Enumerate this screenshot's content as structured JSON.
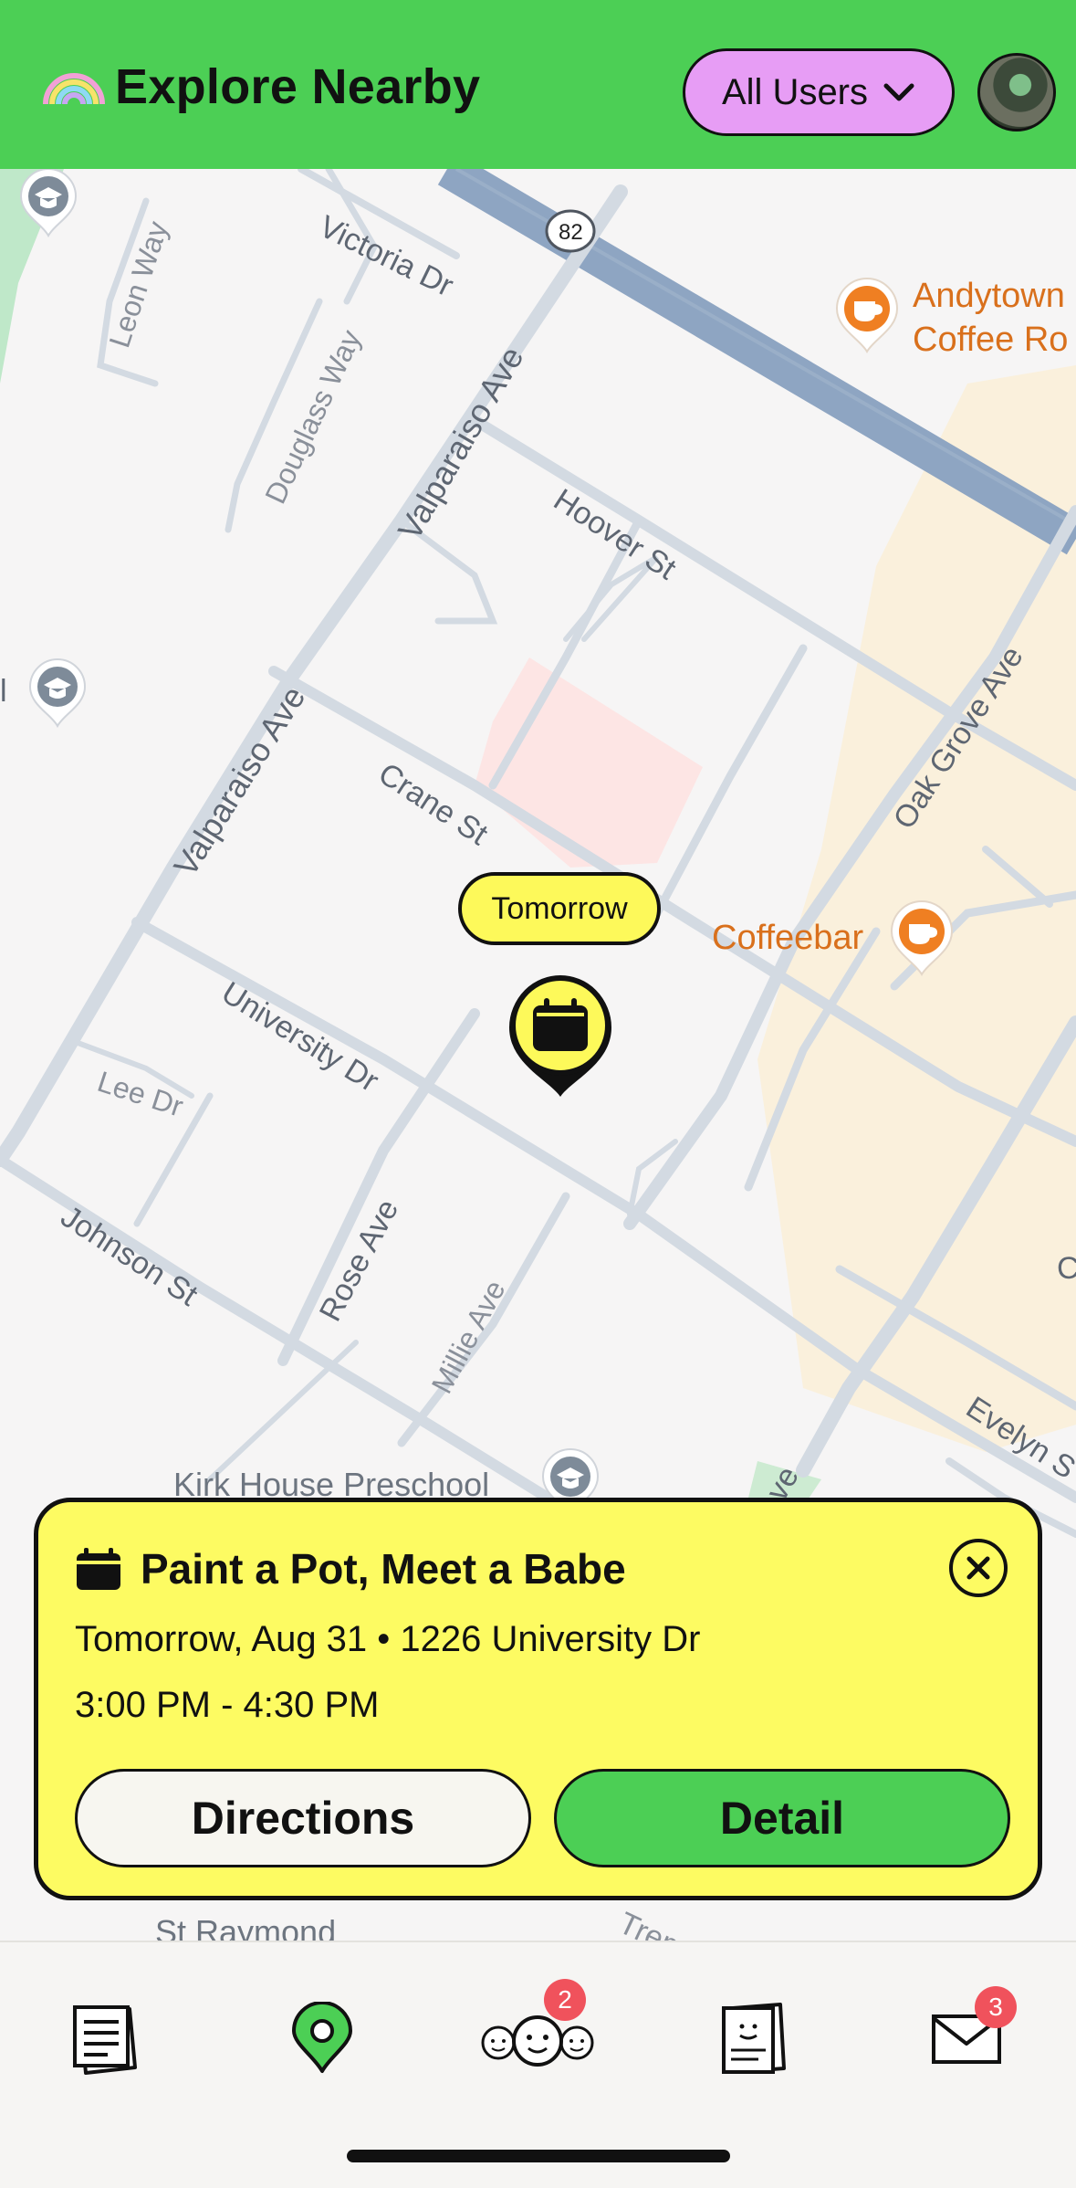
{
  "header": {
    "title": "Explore Nearby",
    "filter_label": "All Users",
    "logo_icon": "rainbow-icon",
    "brand_color": "#4ccf55",
    "filter_color": "#e79df5"
  },
  "map": {
    "streets": [
      "Victoria Dr",
      "Leon Way",
      "Douglass Way",
      "Valparaiso Ave",
      "Hoover St",
      "Valparaiso Ave",
      "Crane St",
      "Oak Grove Ave",
      "University Dr",
      "Lee Dr",
      "Johnson St",
      "Rose Ave",
      "Millie Ave",
      "Evelyn S",
      "Ave",
      "C"
    ],
    "route_shield": "82",
    "pois": {
      "coffee1_line1": "Andytown",
      "coffee1_line2": "Coffee Ro",
      "coffee2": "Coffeebar",
      "school1": "Kirk House Preschool",
      "school2": "St Raymond",
      "fragment_left": "l",
      "fragment_bottom": "Treme"
    },
    "event_marker_label": "Tomorrow"
  },
  "event_card": {
    "title": "Paint a Pot, Meet a Babe",
    "date_location": "Tomorrow, Aug 31 • 1226 University Dr",
    "time": "3:00 PM - 4:30 PM",
    "directions_label": "Directions",
    "detail_label": "Detail",
    "card_color": "#fdfb62"
  },
  "tabbar": {
    "items": [
      {
        "name": "feed",
        "icon": "documents-icon"
      },
      {
        "name": "map",
        "icon": "location-pin-icon",
        "active": true
      },
      {
        "name": "people",
        "icon": "faces-icon",
        "badge": "2"
      },
      {
        "name": "profiles",
        "icon": "profile-card-icon"
      },
      {
        "name": "messages",
        "icon": "mail-icon",
        "badge": "3"
      }
    ]
  }
}
